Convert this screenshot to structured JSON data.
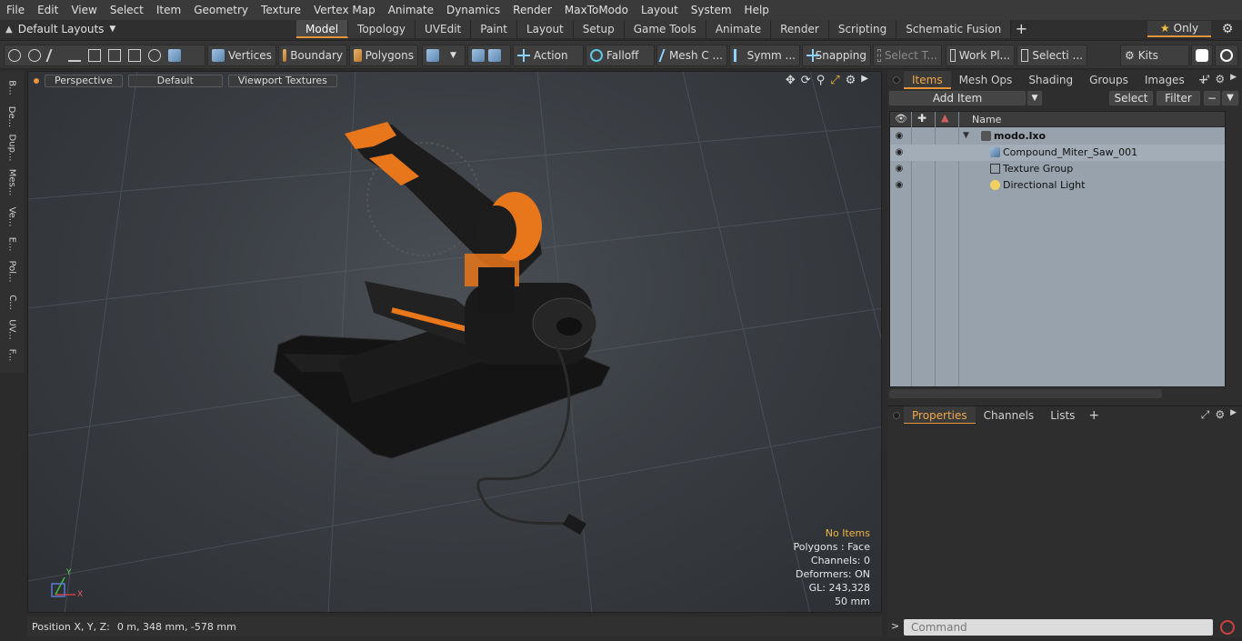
{
  "menu": [
    "File",
    "Edit",
    "View",
    "Select",
    "Item",
    "Geometry",
    "Texture",
    "Vertex Map",
    "Animate",
    "Dynamics",
    "Render",
    "MaxToModo",
    "Layout",
    "System",
    "Help"
  ],
  "layout_selector": "Default Layouts",
  "tabs": [
    {
      "label": "Model",
      "active": true
    },
    {
      "label": "Topology",
      "active": false
    },
    {
      "label": "UVEdit",
      "active": false
    },
    {
      "label": "Paint",
      "active": false
    },
    {
      "label": "Layout",
      "active": false
    },
    {
      "label": "Setup",
      "active": false
    },
    {
      "label": "Game Tools",
      "active": false
    },
    {
      "label": "Animate",
      "active": false
    },
    {
      "label": "Render",
      "active": false
    },
    {
      "label": "Scripting",
      "active": false
    },
    {
      "label": "Schematic Fusion",
      "active": false
    }
  ],
  "only_label": "Only",
  "toolbar": {
    "vertices": "Vertices",
    "boundary": "Boundary",
    "polygons": "Polygons",
    "action": "Action",
    "falloff": "Falloff",
    "mesh_c": "Mesh C ...",
    "symm": "Symm ...",
    "snapping": "Snapping",
    "select_t": "Select T...",
    "work_pl": "Work Pl...",
    "selecti": "Selecti ...",
    "kits": "Kits"
  },
  "left_strip": [
    "B...",
    "De...",
    "Dup...",
    "Mes...",
    "Ve...",
    "E...",
    "Pol...",
    "C...",
    "UV...",
    "F..."
  ],
  "viewport": {
    "perspective": "Perspective",
    "default": "Default",
    "textures": "Viewport Textures",
    "info": {
      "no_items": "No Items",
      "polygons": "Polygons : Face",
      "channels": "Channels: 0",
      "deformers": "Deformers: ON",
      "gl": "GL: 243,328",
      "scale": "50 mm"
    },
    "axis_x": "X",
    "axis_y": "Y"
  },
  "status": {
    "label": "Position X, Y, Z:",
    "value": "0 m, 348 mm, -578 mm"
  },
  "right_panel": {
    "tabs": [
      {
        "label": "Items",
        "active": true
      },
      {
        "label": "Mesh Ops",
        "active": false
      },
      {
        "label": "Shading",
        "active": false
      },
      {
        "label": "Groups",
        "active": false
      },
      {
        "label": "Images",
        "active": false
      }
    ],
    "add_item": "Add Item",
    "select": "Select",
    "filter": "Filter",
    "column_name": "Name",
    "items": [
      {
        "label": "modo.lxo",
        "bold": true,
        "indent": 0
      },
      {
        "label": "Compound_Miter_Saw_001",
        "bold": false,
        "indent": 1
      },
      {
        "label": "Texture Group",
        "bold": false,
        "indent": 1
      },
      {
        "label": "Directional Light",
        "bold": false,
        "indent": 1
      }
    ],
    "props_tabs": [
      {
        "label": "Properties",
        "active": true
      },
      {
        "label": "Channels",
        "active": false
      },
      {
        "label": "Lists",
        "active": false
      }
    ]
  },
  "command": {
    "placeholder": "Command"
  },
  "colors": {
    "accent": "#e8943a",
    "warning_text": "#f0b840",
    "list_bg": "#97a2ad"
  }
}
